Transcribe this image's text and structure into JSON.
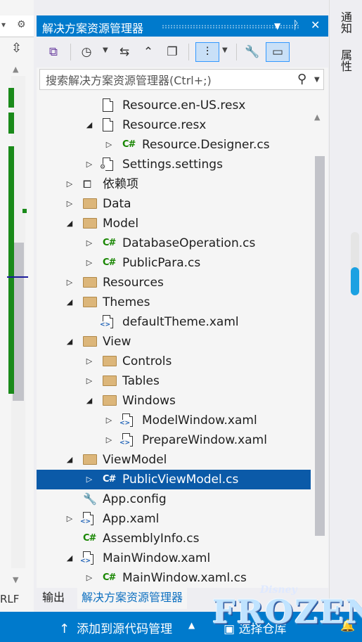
{
  "left_strip": {
    "line_ending": "RLF"
  },
  "panel": {
    "title": "解决方案资源管理器",
    "search_placeholder": "搜索解决方案资源管理器(Ctrl+;)"
  },
  "tree": [
    {
      "label": "Resource.en-US.resx",
      "icon": "resx",
      "indent": 3,
      "arrow": "none"
    },
    {
      "label": "Resource.resx",
      "icon": "resx",
      "indent": 3,
      "arrow": "expanded"
    },
    {
      "label": "Resource.Designer.cs",
      "icon": "cs",
      "indent": 4,
      "arrow": "collapsed"
    },
    {
      "label": "Settings.settings",
      "icon": "settings",
      "indent": 3,
      "arrow": "collapsed"
    },
    {
      "label": "依赖项",
      "icon": "dependencies",
      "indent": 2,
      "arrow": "collapsed"
    },
    {
      "label": "Data",
      "icon": "folder",
      "indent": 2,
      "arrow": "collapsed"
    },
    {
      "label": "Model",
      "icon": "folder",
      "indent": 2,
      "arrow": "expanded"
    },
    {
      "label": "DatabaseOperation.cs",
      "icon": "cs",
      "indent": 3,
      "arrow": "collapsed"
    },
    {
      "label": "PublicPara.cs",
      "icon": "cs",
      "indent": 3,
      "arrow": "collapsed"
    },
    {
      "label": "Resources",
      "icon": "folder",
      "indent": 2,
      "arrow": "collapsed"
    },
    {
      "label": "Themes",
      "icon": "folder",
      "indent": 2,
      "arrow": "expanded"
    },
    {
      "label": "defaultTheme.xaml",
      "icon": "xaml",
      "indent": 3,
      "arrow": "none"
    },
    {
      "label": "View",
      "icon": "folder",
      "indent": 2,
      "arrow": "expanded"
    },
    {
      "label": "Controls",
      "icon": "folder",
      "indent": 3,
      "arrow": "collapsed"
    },
    {
      "label": "Tables",
      "icon": "folder",
      "indent": 3,
      "arrow": "collapsed"
    },
    {
      "label": "Windows",
      "icon": "folder",
      "indent": 3,
      "arrow": "expanded"
    },
    {
      "label": "ModelWindow.xaml",
      "icon": "xaml",
      "indent": 4,
      "arrow": "collapsed"
    },
    {
      "label": "PrepareWindow.xaml",
      "icon": "xaml",
      "indent": 4,
      "arrow": "collapsed"
    },
    {
      "label": "ViewModel",
      "icon": "folder",
      "indent": 2,
      "arrow": "expanded"
    },
    {
      "label": "PublicViewModel.cs",
      "icon": "cs",
      "indent": 3,
      "arrow": "collapsed",
      "selected": true
    },
    {
      "label": "App.config",
      "icon": "config",
      "indent": 2,
      "arrow": "none"
    },
    {
      "label": "App.xaml",
      "icon": "xaml",
      "indent": 2,
      "arrow": "collapsed"
    },
    {
      "label": "AssemblyInfo.cs",
      "icon": "cs",
      "indent": 2,
      "arrow": "none"
    },
    {
      "label": "MainWindow.xaml",
      "icon": "xaml",
      "indent": 2,
      "arrow": "expanded"
    },
    {
      "label": "MainWindow.xaml.cs",
      "icon": "cs",
      "indent": 3,
      "arrow": "collapsed"
    }
  ],
  "tabs": [
    {
      "label": "输出",
      "active": false
    },
    {
      "label": "解决方案资源管理器",
      "active": true
    }
  ],
  "right_side": {
    "notifications": "通知",
    "properties": "属性"
  },
  "status_bar": {
    "source_control": "添加到源代码管理",
    "repository": "选择仓库"
  },
  "logo": {
    "brand": "Disney",
    "title": "FROZEN"
  },
  "colors": {
    "accent": "#007acc",
    "selected_row": "#0b5aa8",
    "cs_icon": "#178600",
    "folder": "#dcb67a"
  }
}
